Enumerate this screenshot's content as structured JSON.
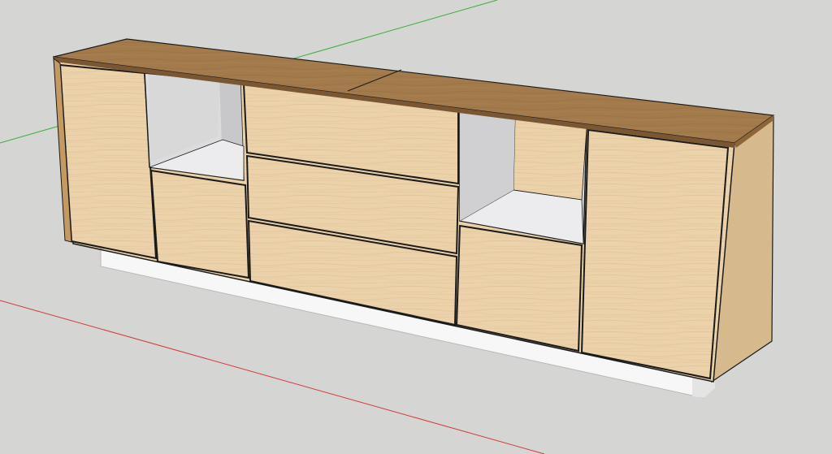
{
  "viewport": {
    "background": "#d5d5d3",
    "axes": {
      "green": "#3cae3c",
      "red": "#d23c3c"
    }
  },
  "model": {
    "wood_light": "#ecd2aa",
    "wood_grain": "#dcbd92",
    "top_color": "#a37a4c",
    "top_edge": "#7a5632",
    "side_color": "#d6b98d",
    "plinth": "#f7f7f7",
    "plinth_side": "#e4e4e4",
    "cubby_inner": "#dcdcde",
    "cubby_back": "#c8c8ca",
    "cubby_floor": "#ececee",
    "outline": "#1b1b1b"
  }
}
